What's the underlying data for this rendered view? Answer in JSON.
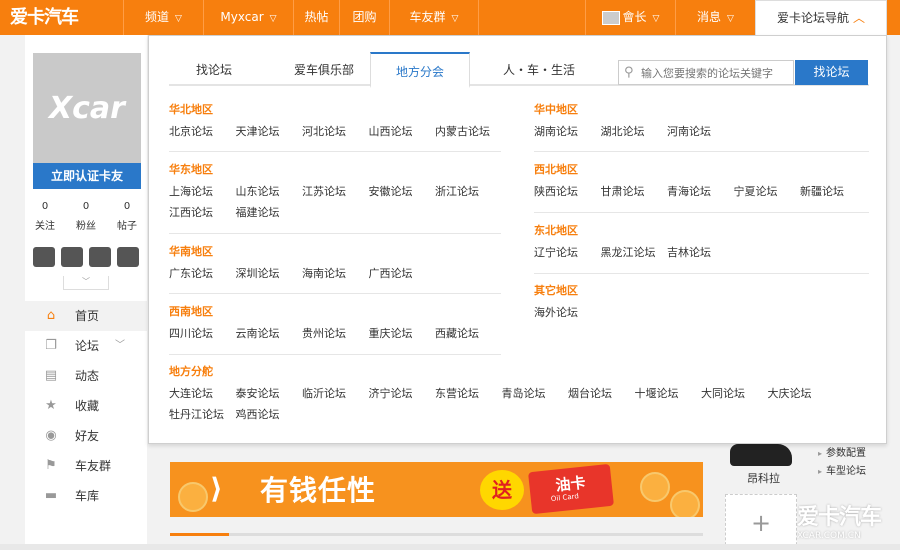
{
  "topbar": {
    "logo": "爱卡汽车",
    "nav": [
      {
        "label": "频道",
        "has_chevron": true
      },
      {
        "label": "Myxcar",
        "has_chevron": true
      },
      {
        "label": "热帖",
        "has_chevron": false
      },
      {
        "label": "团购",
        "has_chevron": false
      },
      {
        "label": "车友群",
        "has_chevron": true
      }
    ],
    "user_label": "會长",
    "messages_label": "消息",
    "guide_label": "爱卡论坛导航"
  },
  "sidebar": {
    "profile_watermark": "Xcar",
    "verify_button": "立即认证卡友",
    "stats": [
      {
        "value": "0",
        "label": "关注"
      },
      {
        "value": "0",
        "label": "粉丝"
      },
      {
        "value": "0",
        "label": "帖子"
      }
    ],
    "menu": [
      {
        "label": "首页",
        "icon": "home-icon",
        "glyph": "⌂",
        "active": true
      },
      {
        "label": "论坛",
        "icon": "forum-icon",
        "glyph": "❐",
        "active": false,
        "chevron": true
      },
      {
        "label": "动态",
        "icon": "chat-icon",
        "glyph": "▤",
        "active": false
      },
      {
        "label": "收藏",
        "icon": "star-icon",
        "glyph": "★",
        "active": false
      },
      {
        "label": "好友",
        "icon": "friends-icon",
        "glyph": "👥",
        "active": false
      },
      {
        "label": "车友群",
        "icon": "flag-icon",
        "glyph": "⚑",
        "active": false
      },
      {
        "label": "车库",
        "icon": "car-icon",
        "glyph": "🚗",
        "active": false
      }
    ]
  },
  "dropdown": {
    "tabs": [
      {
        "label": "找论坛",
        "active": false
      },
      {
        "label": "爱车俱乐部",
        "active": false
      },
      {
        "label": "地方分会",
        "active": true
      },
      {
        "label": "人・车・生活",
        "active": false
      }
    ],
    "search_placeholder": "输入您要搜索的论坛关键字",
    "search_button": "找论坛",
    "regions_left": [
      {
        "title": "华北地区",
        "links": [
          "北京论坛",
          "天津论坛",
          "河北论坛",
          "山西论坛",
          "内蒙古论坛"
        ]
      },
      {
        "title": "华东地区",
        "links": [
          "上海论坛",
          "山东论坛",
          "江苏论坛",
          "安徽论坛",
          "浙江论坛",
          "江西论坛",
          "福建论坛"
        ]
      },
      {
        "title": "华南地区",
        "links": [
          "广东论坛",
          "深圳论坛",
          "海南论坛",
          "广西论坛"
        ]
      },
      {
        "title": "西南地区",
        "links": [
          "四川论坛",
          "云南论坛",
          "贵州论坛",
          "重庆论坛",
          "西藏论坛"
        ]
      }
    ],
    "regions_right": [
      {
        "title": "华中地区",
        "links": [
          "湖南论坛",
          "湖北论坛",
          "河南论坛"
        ]
      },
      {
        "title": "西北地区",
        "links": [
          "陕西论坛",
          "甘肃论坛",
          "青海论坛",
          "宁夏论坛",
          "新疆论坛"
        ]
      },
      {
        "title": "东北地区",
        "links": [
          "辽宁论坛",
          "黑龙江论坛",
          "吉林论坛"
        ]
      },
      {
        "title": "其它地区",
        "links": [
          "海外论坛"
        ]
      }
    ],
    "local": {
      "title": "地方分舵",
      "links": [
        "大连论坛",
        "泰安论坛",
        "临沂论坛",
        "济宁论坛",
        "东营论坛",
        "青岛论坛",
        "烟台论坛",
        "十堰论坛",
        "大同论坛",
        "大庆论坛",
        "牡丹江论坛",
        "鸡西论坛"
      ]
    }
  },
  "banner": {
    "headline": "有钱任性",
    "gift": "送",
    "card": "油卡",
    "card_sub": "Oil Card",
    "progress": 0.11
  },
  "right": {
    "car_name": "昂科拉",
    "links": [
      "参数配置",
      "车型论坛"
    ],
    "add": "+"
  },
  "watermark": {
    "cn": "爱卡汽车",
    "url": "XCAR.COM.CN"
  },
  "colors": {
    "accent": "#f77f0e",
    "blue": "#2a78c9"
  }
}
